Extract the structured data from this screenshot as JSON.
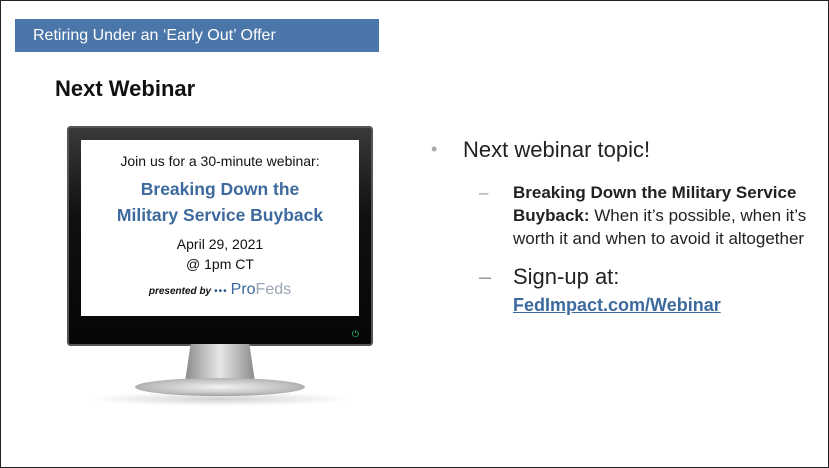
{
  "header": {
    "banner": "Retiring Under an ‘Early Out’ Offer"
  },
  "slide_title": "Next Webinar",
  "monitor_screen": {
    "line1": "Join us for a 30-minute webinar:",
    "headline_line1": "Breaking Down the",
    "headline_line2": "Military Service Buyback",
    "date": "April 29, 2021",
    "time": "@ 1pm CT",
    "presented_by": "presented by",
    "dots": "•••",
    "brand_pro": "Pro",
    "brand_feds": "Feds"
  },
  "bullets": {
    "main": "Next webinar topic!",
    "bullet_glyph": "•",
    "sub1_bold": "Breaking Down the Military Service Buyback:",
    "sub1_text": "When it’s possible, when it’s worth it and when to avoid it altogether",
    "sub2_text": "Sign-up at:",
    "sub2_link": "FedImpact.com/Webinar",
    "dash": "–"
  },
  "colors": {
    "banner": "#4a76a9",
    "accent": "#3d6a9e",
    "power": "#2ecc71"
  }
}
